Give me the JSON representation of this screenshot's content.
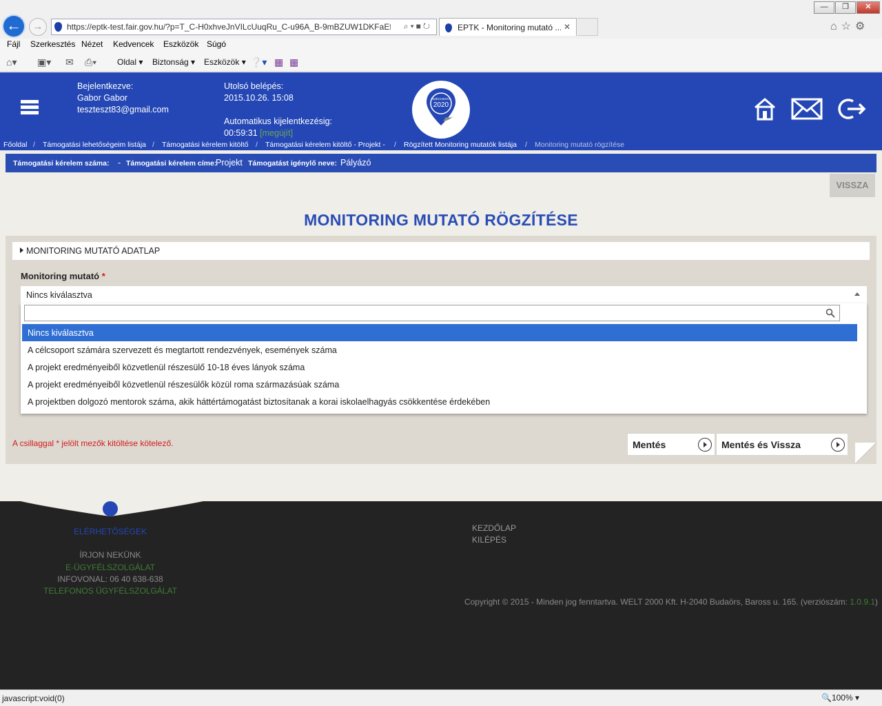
{
  "browser": {
    "url": "https://eptk-test.fair.gov.hu/?p=T_C-H0xhveJnVILcUuqRu_C-u96A_B-9mBZUW1DKFaEfU",
    "tab_title": "EPTK - Monitoring mutató ...",
    "menu": [
      "Fájl",
      "Szerkesztés",
      "Nézet",
      "Kedvencek",
      "Eszközök",
      "Súgó"
    ],
    "commands": [
      "Oldal",
      "Biztonság",
      "Eszközök"
    ],
    "status_text": "javascript:void(0)",
    "zoom": "100%"
  },
  "header": {
    "logged_in_label": "Bejelentkezve:",
    "user_name": "Gabor Gabor",
    "user_email": "teszteszt83@gmail.com",
    "last_login_label": "Utolsó belépés:",
    "last_login_value": "2015.10.26. 15:08",
    "auto_logout_label": "Automatikus kijelentkezésig:",
    "auto_logout_value": "00:59:31",
    "renew_label": "[megújít]",
    "logo_text_top": "SZÉCHENYI",
    "logo_text_year": "2020"
  },
  "breadcrumb": {
    "items": [
      "Főoldal",
      "Támogatási lehetőségeim listája",
      "Támogatási kérelem kitöltő",
      "Támogatási kérelem kitöltő - Projekt -",
      "Rögzített Monitoring mutatók listája"
    ],
    "current": "Monitoring mutató rögzítése",
    "separator": "/"
  },
  "app_bar": {
    "number_label": "Támogatási kérelem száma:",
    "number_value": "-",
    "title_label": "Támogatási kérelem címe:",
    "title_value": "Projekt",
    "applicant_label": "Támogatást igénylő neve:",
    "applicant_value": "Pályázó"
  },
  "back_button": "VISSZA",
  "page_title": "MONITORING MUTATÓ RÖGZÍTÉSE",
  "form": {
    "section_title": "MONITORING MUTATÓ ADATLAP",
    "field_label": "Monitoring mutató",
    "required_mark": "*",
    "selected_value": "Nincs kiválasztva",
    "search_value": "",
    "options": [
      "Nincs kiválasztva",
      "A célcsoport számára szervezett és megtartott rendezvények, események száma",
      "A projekt eredményeiből közvetlenül részesülő 10-18 éves lányok száma",
      "A projekt eredményeiből közvetlenül részesülők közül roma származásúak száma",
      "A projektben dolgozó mentorok száma, akik háttértámogatást biztosítanak a korai iskolaelhagyás csökkentése érdekében"
    ],
    "required_note": "A csillaggal * jelölt mezők kitöltése kötelező.",
    "save_label": "Mentés",
    "save_back_label": "Mentés és Vissza"
  },
  "footer": {
    "contacts_label": "ELÉRHETŐSÉGEK",
    "write_us": "ÍRJON NEKÜNK",
    "e_service": "E-ÜGYFÉLSZOLGÁLAT",
    "infoline": "INFOVONAL: 06 40 638-638",
    "phone_service": "TELEFONOS ÜGYFÉLSZOLGÁLAT",
    "home": "KEZDŐLAP",
    "logout": "KILÉPÉS",
    "copyright": "Copyright © 2015 - Minden jog fenntartva. WELT 2000 Kft. H-2040 Budaörs, Baross u. 165. (verziószám:",
    "version": "1.0.9.1",
    "copyright_end": ")"
  },
  "colors": {
    "brand_blue": "#2447b5",
    "selected_option": "#2f6fd4",
    "required_red": "#d21a1a",
    "footer_green": "#3f7d35"
  }
}
